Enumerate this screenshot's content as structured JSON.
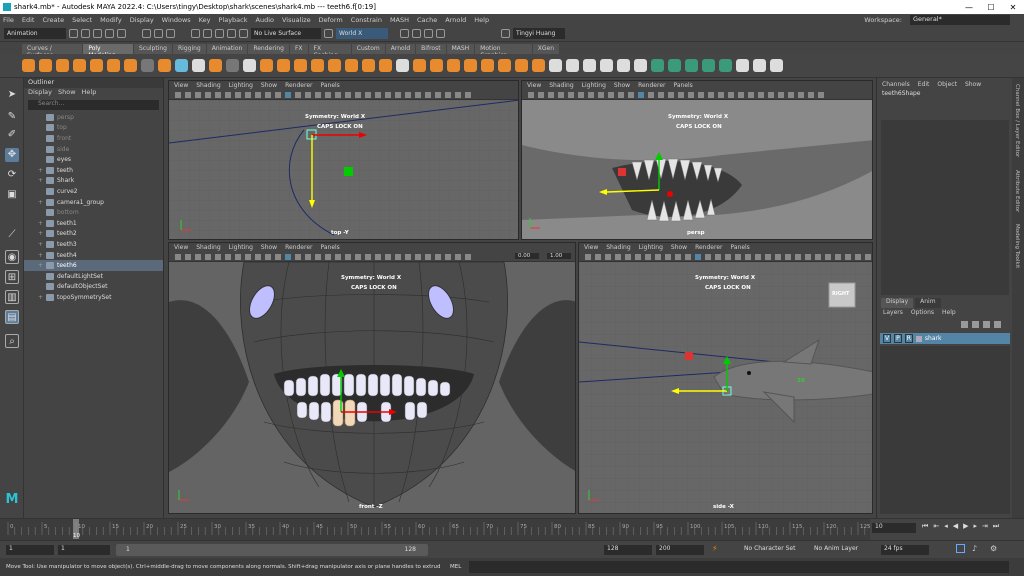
{
  "window": {
    "title": "shark4.mb* - Autodesk MAYA 2022.4: C:\\Users\\tingy\\Desktop\\shark\\scenes\\shark4.mb  ---  teeth6.f[0:19]",
    "minimize": "—",
    "maximize": "☐",
    "close": "✕"
  },
  "menubar": {
    "items": [
      "File",
      "Edit",
      "Create",
      "Select",
      "Modify",
      "Display",
      "Windows",
      "Key",
      "Playback",
      "Audio",
      "Visualize",
      "Deform",
      "Constrain",
      "MASH",
      "Cache",
      "Arnold",
      "Help"
    ],
    "workspace_label": "Workspace:",
    "workspace_value": "General*"
  },
  "statusline": {
    "menuset": "Animation",
    "live_surface": "No Live Surface",
    "symmetry": "World X",
    "user": "Tingyi Huang"
  },
  "shelf": {
    "tabs": [
      "Curves / Surfaces",
      "Poly Modeling",
      "Sculpting",
      "Rigging",
      "Animation",
      "Rendering",
      "FX",
      "FX Caching",
      "Custom",
      "Arnold",
      "Bifrost",
      "MASH",
      "Motion Graphics",
      "XGen"
    ],
    "active_tab": "Poly Modeling"
  },
  "outliner": {
    "title": "Outliner",
    "menu": [
      "Display",
      "Show",
      "Help"
    ],
    "search_placeholder": "Search...",
    "items": [
      {
        "label": "persp",
        "dim": true,
        "expand": ""
      },
      {
        "label": "top",
        "dim": true,
        "expand": ""
      },
      {
        "label": "front",
        "dim": true,
        "expand": ""
      },
      {
        "label": "side",
        "dim": true,
        "expand": ""
      },
      {
        "label": "eyes",
        "dim": false,
        "expand": ""
      },
      {
        "label": "teeth",
        "dim": false,
        "expand": "+"
      },
      {
        "label": "Shark",
        "dim": false,
        "expand": "+"
      },
      {
        "label": "curve2",
        "dim": false,
        "expand": ""
      },
      {
        "label": "camera1_group",
        "dim": false,
        "expand": "+"
      },
      {
        "label": "bottom",
        "dim": true,
        "expand": ""
      },
      {
        "label": "teeth1",
        "dim": false,
        "expand": "+"
      },
      {
        "label": "teeth2",
        "dim": false,
        "expand": "+"
      },
      {
        "label": "teeth3",
        "dim": false,
        "expand": "+"
      },
      {
        "label": "teeth4",
        "dim": false,
        "expand": "+"
      },
      {
        "label": "teeth6",
        "dim": false,
        "expand": "+",
        "selected": true
      },
      {
        "label": "defaultLightSet",
        "dim": false,
        "expand": ""
      },
      {
        "label": "defaultObjectSet",
        "dim": false,
        "expand": ""
      },
      {
        "label": "topoSymmetrySet",
        "dim": false,
        "expand": "+"
      }
    ]
  },
  "viewport": {
    "menu": [
      "View",
      "Shading",
      "Lighting",
      "Show",
      "Renderer",
      "Panels"
    ],
    "symmetry_hud": "Symmetry: World X",
    "caps_hud": "CAPS LOCK ON",
    "top_label": "top -Y",
    "persp_label": "persp",
    "front_label": "front -Z",
    "side_label": "side -X",
    "field_a": "0.00",
    "field_b": "1.00",
    "right_cube": "RIGHT",
    "side_number": "20"
  },
  "channelbox": {
    "menu": [
      "Channels",
      "Edit",
      "Object",
      "Show"
    ],
    "object": "teeth6Shape",
    "layer_tabs": [
      "Display",
      "Anim"
    ],
    "layer_menu": [
      "Layers",
      "Options",
      "Help"
    ],
    "layer_v": "V",
    "layer_p": "P",
    "layer_r": "R",
    "layer_name": "shark",
    "side_tabs": [
      "Channel Box / Layer Editor",
      "Attribute Editor",
      "Modeling Toolkit"
    ]
  },
  "timeline": {
    "ticks": [
      "0",
      "5",
      "10",
      "15",
      "20",
      "25",
      "30",
      "35",
      "40",
      "45",
      "50",
      "55",
      "60",
      "65",
      "70",
      "75",
      "80",
      "85",
      "90",
      "95",
      "100",
      "105",
      "110",
      "115",
      "120",
      "125"
    ],
    "current_frame": "10",
    "current_field": "10"
  },
  "range": {
    "start": "1",
    "anim_start": "1",
    "slider_start": "1",
    "slider_end": "128",
    "anim_end": "128",
    "end": "200",
    "character": "No Character Set",
    "anim_layer": "No Anim Layer",
    "fps": "24 fps"
  },
  "help": {
    "text": "Move Tool: Use manipulator to move object(s). Ctrl+middle-drag to move components along normals. Shift+drag manipulator axis or plane handles to extrude components or c",
    "cmd_label": "MEL"
  }
}
